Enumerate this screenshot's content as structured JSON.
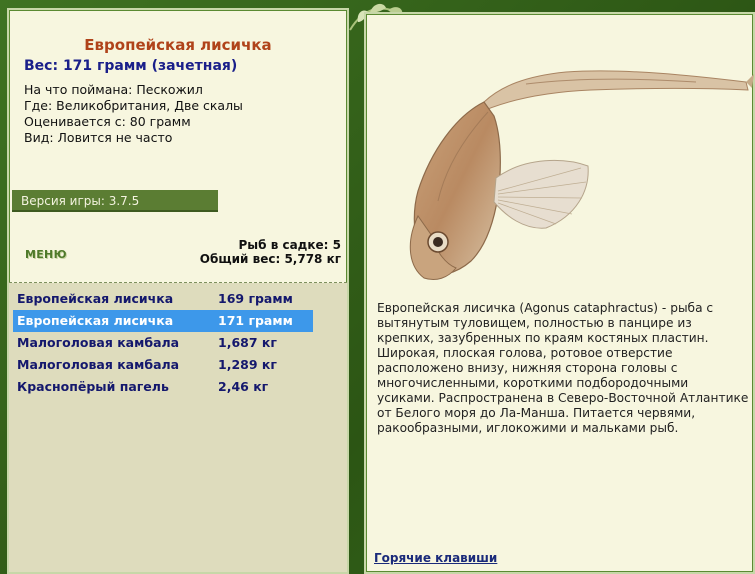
{
  "fish_info": {
    "title": "Европейская лисичка",
    "weight": "Вес: 171 грамм (зачетная)",
    "bait": "На что поймана: Пескожил",
    "location": "Где: Великобритания, Две скалы",
    "valued_from": "Оценивается с: 80 грамм",
    "frequency": "Вид: Ловится не часто"
  },
  "version": "Версия игры: 3.7.5",
  "menu_label": "МЕНЮ",
  "keepnet": {
    "count": "Рыб в садке: 5",
    "total_weight": "Общий вес: 5,778 кг"
  },
  "catch_list": [
    {
      "name": "Европейская лисичка",
      "weight": "169 грамм",
      "selected": false
    },
    {
      "name": "Европейская лисичка",
      "weight": "171 грамм",
      "selected": true
    },
    {
      "name": "Малоголовая камбала",
      "weight": "1,687 кг",
      "selected": false
    },
    {
      "name": "Малоголовая камбала",
      "weight": "1,289 кг",
      "selected": false
    },
    {
      "name": "Краснопёрый пагель",
      "weight": "2,46 кг",
      "selected": false
    }
  ],
  "description": "Европейская лисичка (Agonus cataphractus) - рыба с вытянутым туловищем, полностью в панцире из крепких, зазубренных по краям костяных пластин. Широкая, плоская голова, ротовое отверстие расположено внизу, нижняя сторона головы с многочисленными, короткими подбородочными усиками. Распространена в Северо-Восточной Атлантике от Белого моря до Ла-Манша. Питается червями, ракообразными, иглокожими и мальками рыб.",
  "hotkeys_label": "Горячие клавиши",
  "colors": {
    "frame": "#2f5a17",
    "panel": "#f7f6df",
    "title": "#b0431a",
    "selected_row": "#3d98ea",
    "list_text": "#14186d"
  }
}
